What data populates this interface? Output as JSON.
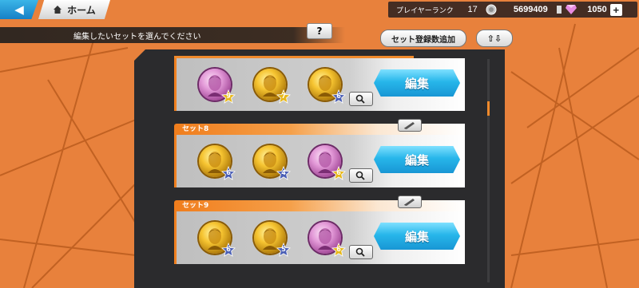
{
  "nav": {
    "back_label": "◀",
    "home_label": "ホーム"
  },
  "status": {
    "rank_label": "プレイヤーランク",
    "rank_value": "17",
    "coins": "5699409",
    "gems": "1050",
    "plus_label": "+"
  },
  "instruction": {
    "text": "編集したいセットを選んでください",
    "help_label": "?"
  },
  "toolbar": {
    "add_slots_label": "セット登録数追加",
    "sort_label": "⇧⇩"
  },
  "colors": {
    "accent": "#f08a2c",
    "edit_button": "#27b6ea",
    "panel": "#2b2b2d",
    "background": "#e8813c"
  },
  "sets": [
    {
      "name": "",
      "edit_label": "編集",
      "medals": [
        {
          "color": "pink",
          "level": "9"
        },
        {
          "color": "gold",
          "level": "7"
        },
        {
          "color": "gold",
          "level": "6"
        }
      ]
    },
    {
      "name": "セット8",
      "edit_label": "編集",
      "medals": [
        {
          "color": "gold",
          "level": "6"
        },
        {
          "color": "gold",
          "level": "4"
        },
        {
          "color": "pink",
          "level": "6"
        }
      ]
    },
    {
      "name": "セット9",
      "edit_label": "編集",
      "medals": [
        {
          "color": "gold",
          "level": "6"
        },
        {
          "color": "gold",
          "level": "5"
        },
        {
          "color": "pink",
          "level": "6"
        }
      ]
    }
  ]
}
